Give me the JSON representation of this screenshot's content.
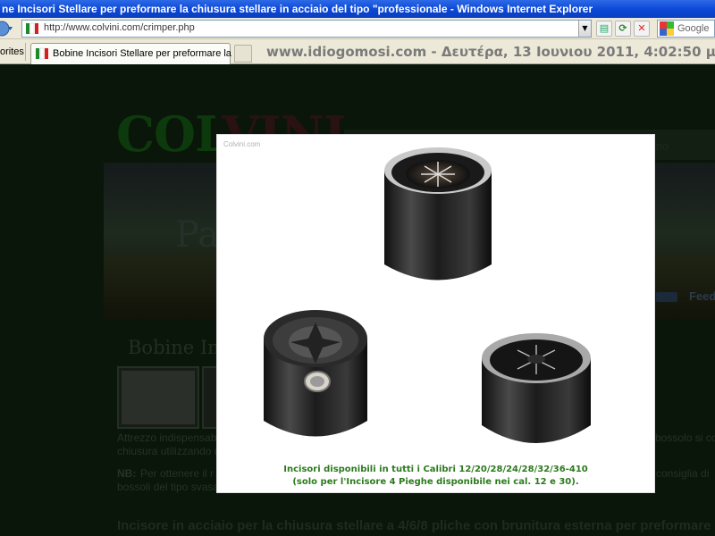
{
  "browser": {
    "window_title": "ne Incisori Stellare per preformare la chiusura stellare in acciaio del tipo \"professionale - Windows Internet Explorer",
    "url": "http://www.colvini.com/crimper.php",
    "search_provider": "Google",
    "favorites_label": "orites",
    "tab_title": "Bobine Incisori Stellare per preformare la ...",
    "clock_text": "www.idiogomosi.com - Δευτέρα, 13 Ιουνιου 2011, 4:02:50 μμ"
  },
  "page": {
    "logo_col": "COL",
    "logo_vini": "VINI",
    "menu_fragment": "mo",
    "banner_fragment": "Pas",
    "feed_label": "Feed",
    "section_title": "Bobine In",
    "text_line1_left": "Attrezzo indispensab",
    "text_line1_right": "bossolo si con",
    "text_line2_left": "chiusura utilizzando u",
    "nb_label": "NB:",
    "nb_left": "Per ottenere il r",
    "nb_right": "consiglia di",
    "text_line4_left": "bossoli del tipo svasa",
    "bottom_heading": "Incisore in acciaio per la chiusura stellare a 4/6/8 pliche con brunitura esterna per preformare la"
  },
  "lightbox": {
    "watermark": "Colvini.com",
    "caption_line1": "Incisori disponibili in tutti i Calibri 12/20/28/24/28/32/36-410",
    "caption_line2": "(solo per l'Incisore 4 Pieghe disponibile nei cal. 12 e 30).",
    "photo_subjects": [
      "8-fold crimper",
      "4-fold crimper",
      "6-fold crimper"
    ]
  },
  "colors": {
    "caption_green": "#2b7a1b",
    "titlebar_blue": "#0b46d6",
    "page_dark": "#0a160a"
  }
}
